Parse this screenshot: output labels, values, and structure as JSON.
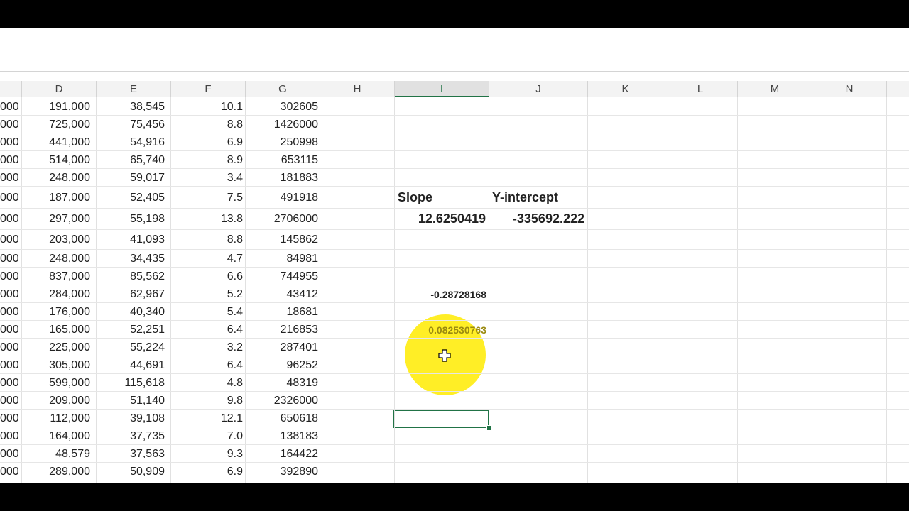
{
  "columns": [
    "D",
    "E",
    "F",
    "G",
    "H",
    "I",
    "J",
    "K",
    "L",
    "M",
    "N"
  ],
  "selected_column": "I",
  "rows": [
    {
      "c": "000",
      "d": "191,000",
      "e": "38,545",
      "f": "10.1",
      "g": "302605"
    },
    {
      "c": "000",
      "d": "725,000",
      "e": "75,456",
      "f": "8.8",
      "g": "1426000"
    },
    {
      "c": "000",
      "d": "441,000",
      "e": "54,916",
      "f": "6.9",
      "g": "250998"
    },
    {
      "c": "000",
      "d": "514,000",
      "e": "65,740",
      "f": "8.9",
      "g": "653115"
    },
    {
      "c": "000",
      "d": "248,000",
      "e": "59,017",
      "f": "3.4",
      "g": "181883"
    },
    {
      "c": "000",
      "d": "187,000",
      "e": "52,405",
      "f": "7.5",
      "g": "491918"
    },
    {
      "c": "000",
      "d": "297,000",
      "e": "55,198",
      "f": "13.8",
      "g": "2706000"
    },
    {
      "c": "000",
      "d": "203,000",
      "e": "41,093",
      "f": "8.8",
      "g": "145862"
    },
    {
      "c": "000",
      "d": "248,000",
      "e": "34,435",
      "f": "4.7",
      "g": "84981"
    },
    {
      "c": "000",
      "d": "837,000",
      "e": "85,562",
      "f": "6.6",
      "g": "744955"
    },
    {
      "c": "000",
      "d": "284,000",
      "e": "62,967",
      "f": "5.2",
      "g": "43412"
    },
    {
      "c": "000",
      "d": "176,000",
      "e": "40,340",
      "f": "5.4",
      "g": "18681"
    },
    {
      "c": "000",
      "d": "165,000",
      "e": "52,251",
      "f": "6.4",
      "g": "216853"
    },
    {
      "c": "000",
      "d": "225,000",
      "e": "55,224",
      "f": "3.2",
      "g": "287401"
    },
    {
      "c": "000",
      "d": "305,000",
      "e": "44,691",
      "f": "6.4",
      "g": "96252"
    },
    {
      "c": "000",
      "d": "599,000",
      "e": "115,618",
      "f": "4.8",
      "g": "48319"
    },
    {
      "c": "000",
      "d": "209,000",
      "e": "51,140",
      "f": "9.8",
      "g": "2326000"
    },
    {
      "c": "000",
      "d": "112,000",
      "e": "39,108",
      "f": "12.1",
      "g": "650618"
    },
    {
      "c": "000",
      "d": "164,000",
      "e": "37,735",
      "f": "7.0",
      "g": "138183"
    },
    {
      "c": "000",
      "d": "48,579",
      "e": "37,563",
      "f": "9.3",
      "g": "164422"
    },
    {
      "c": "000",
      "d": "289,000",
      "e": "50,909",
      "f": "6.9",
      "g": "392890"
    }
  ],
  "analysis": {
    "slope_label": "Slope",
    "intercept_label": "Y-intercept",
    "slope_value": "12.6250419",
    "intercept_value": "-335692.222",
    "correlation_value": "-0.28728168",
    "r_squared_value": "0.082530763"
  },
  "colors": {
    "accent": "#217346",
    "highlight": "#ffeb00"
  }
}
